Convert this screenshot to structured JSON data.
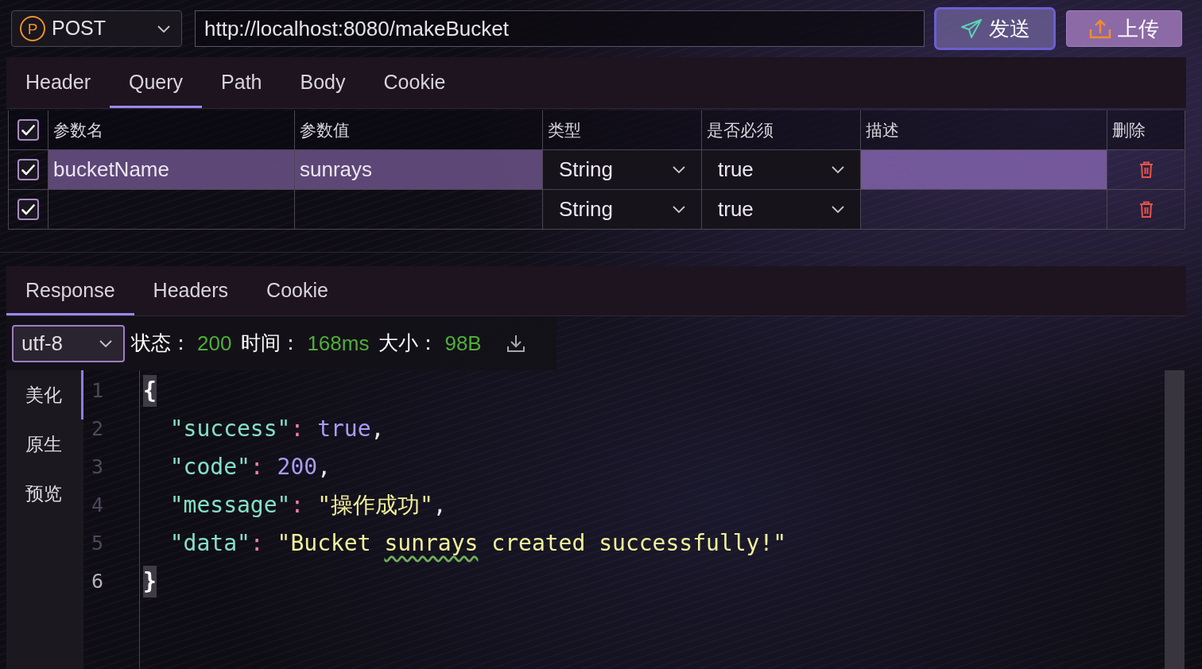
{
  "request": {
    "method": {
      "badge": "P",
      "label": "POST"
    },
    "url": "http://localhost:8080/makeBucket",
    "send_label": "发送",
    "upload_label": "上传"
  },
  "request_tabs": [
    {
      "label": "Header",
      "selected": false
    },
    {
      "label": "Query",
      "selected": true
    },
    {
      "label": "Path",
      "selected": false
    },
    {
      "label": "Body",
      "selected": false
    },
    {
      "label": "Cookie",
      "selected": false
    }
  ],
  "params_table": {
    "all_checked": true,
    "columns": [
      "参数名",
      "参数值",
      "类型",
      "是否必须",
      "描述",
      "删除"
    ],
    "rows": [
      {
        "checked": true,
        "selected": true,
        "name": "bucketName",
        "value": "sunrays",
        "type": "String",
        "required": "true"
      },
      {
        "checked": true,
        "selected": false,
        "type": "String",
        "required": "true"
      }
    ]
  },
  "response_tabs": [
    {
      "label": "Response",
      "selected": true
    },
    {
      "label": "Headers",
      "selected": false
    },
    {
      "label": "Cookie",
      "selected": false
    }
  ],
  "response_status": {
    "encoding": "utf-8",
    "items": [
      {
        "label": "状态：",
        "value": "200"
      },
      {
        "label": "时间：",
        "value": "168ms"
      },
      {
        "label": "大小：",
        "value": "98B"
      }
    ]
  },
  "view_modes": [
    {
      "label": "美化",
      "selected": true
    },
    {
      "label": "原生",
      "selected": false
    },
    {
      "label": "预览",
      "selected": false
    }
  ],
  "response_body": {
    "lines": [
      {
        "number": "1",
        "current": false,
        "indented": false,
        "tokens": [
          {
            "kind": "brace_match",
            "text": "{"
          }
        ]
      },
      {
        "number": "2",
        "current": false,
        "indented": true,
        "tokens": [
          {
            "kind": "key",
            "text": "\"success\""
          },
          {
            "kind": "colon",
            "text": ": "
          },
          {
            "kind": "literal",
            "text": "true"
          },
          {
            "kind": "punct",
            "text": ","
          }
        ]
      },
      {
        "number": "3",
        "current": false,
        "indented": true,
        "tokens": [
          {
            "kind": "key",
            "text": "\"code\""
          },
          {
            "kind": "colon",
            "text": ": "
          },
          {
            "kind": "literal",
            "text": "200"
          },
          {
            "kind": "punct",
            "text": ","
          }
        ]
      },
      {
        "number": "4",
        "current": false,
        "indented": true,
        "tokens": [
          {
            "kind": "key",
            "text": "\"message\""
          },
          {
            "kind": "colon",
            "text": ": "
          },
          {
            "kind": "string",
            "text": "\"操作成功\""
          },
          {
            "kind": "punct",
            "text": ","
          }
        ]
      },
      {
        "number": "5",
        "current": false,
        "indented": true,
        "tokens": [
          {
            "kind": "key",
            "text": "\"data\""
          },
          {
            "kind": "colon",
            "text": ": "
          },
          {
            "kind": "string",
            "text": "\"Bucket "
          },
          {
            "kind": "typo",
            "text": "sunrays"
          },
          {
            "kind": "string",
            "text": " created successfully!\""
          }
        ]
      },
      {
        "number": "6",
        "current": true,
        "indented": false,
        "tokens": [
          {
            "kind": "brace_match",
            "text": "}"
          }
        ]
      }
    ]
  }
}
